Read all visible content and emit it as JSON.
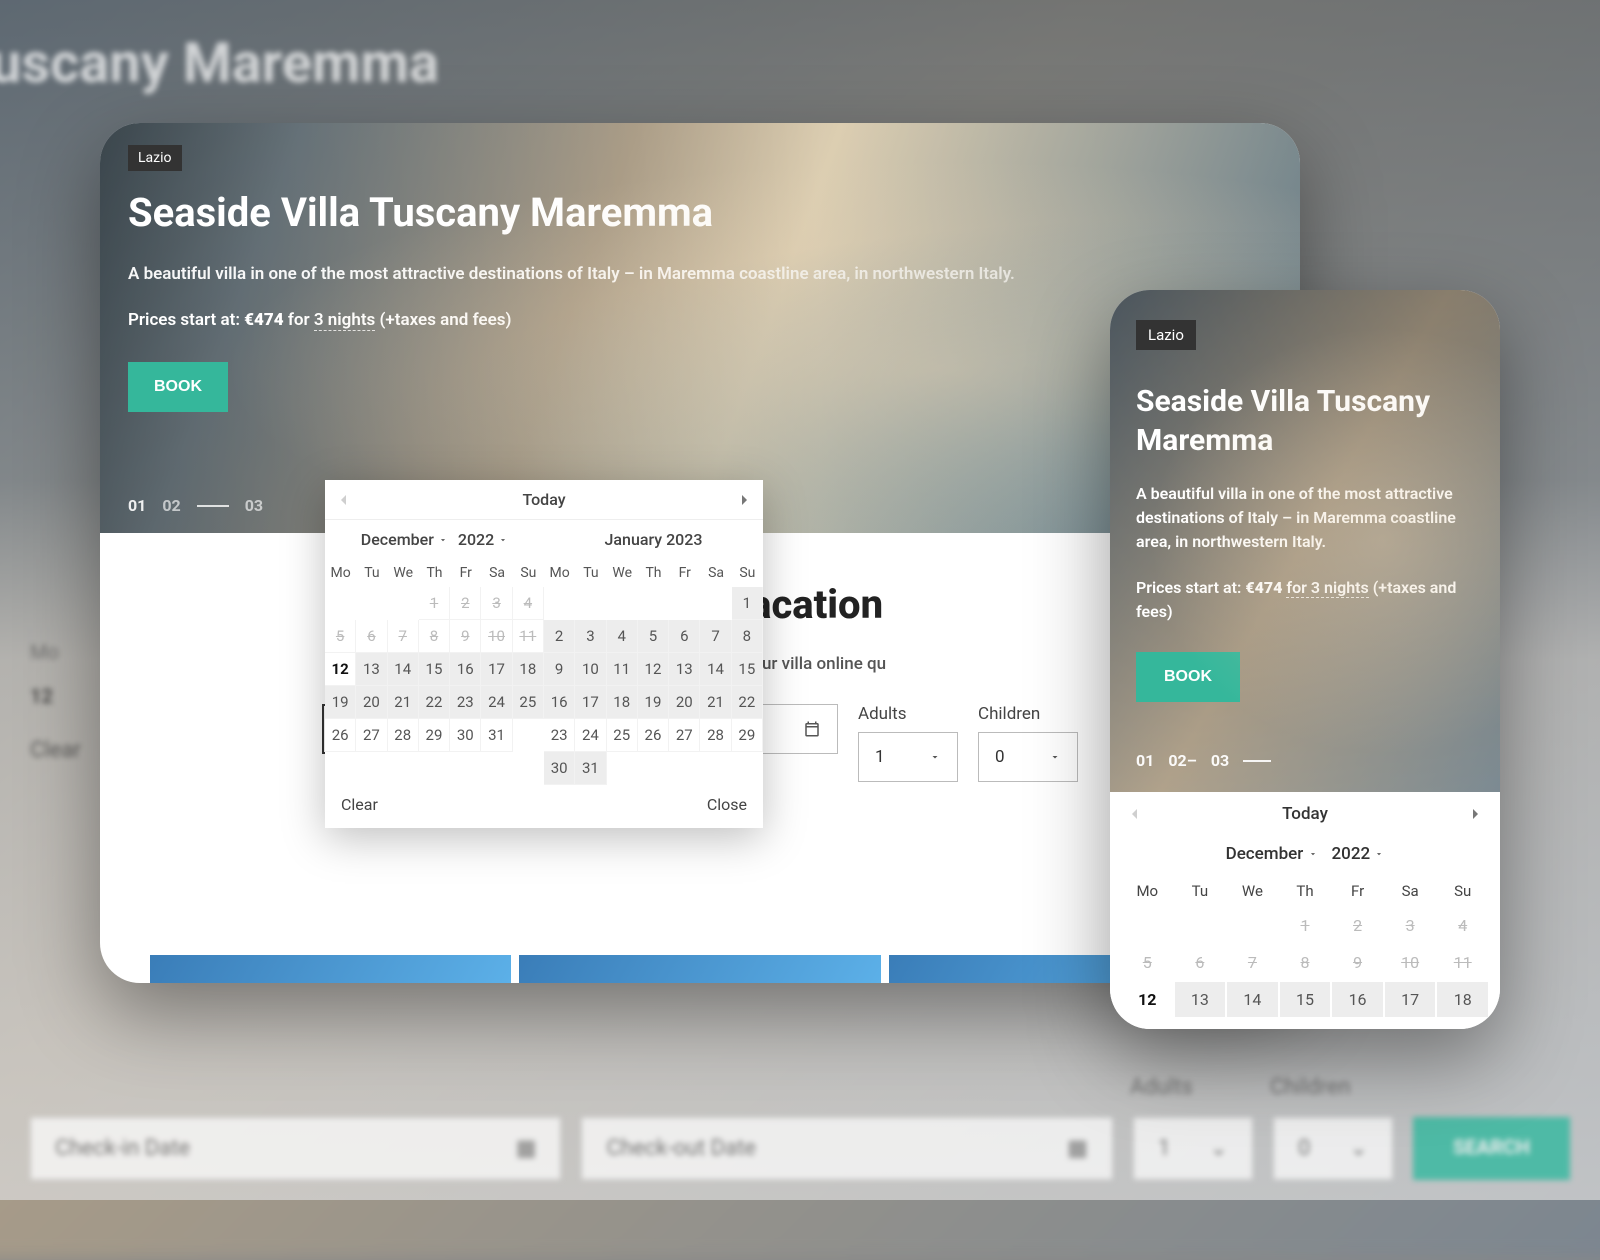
{
  "background": {
    "blurred_title": "uscany Maremma",
    "clear": "Clear",
    "close": "Close",
    "checkin": "Check-in Date",
    "checkout": "Check-out Date",
    "adults_label": "Adults",
    "adults_value": "1",
    "children_label": "Children",
    "children_value": "0",
    "search": "SEARCH"
  },
  "hero": {
    "tag": "Lazio",
    "title": "Seaside Villa Tuscany Maremma",
    "description": "A beautiful villa in one of the most attractive destinations of Italy – in Maremma coastline area, in northwestern Italy.",
    "price_prefix": "Prices start at: ",
    "price_amount": "€474",
    "price_mid": " for ",
    "nights": "3 nights",
    "price_suffix": " (+taxes and fees)",
    "book_label": "BOOK",
    "indicators": [
      "01",
      "02",
      "03"
    ]
  },
  "marketing": {
    "headline_fragment": "ert for your vacation",
    "subline_fragment": "nd your dream vacation. Book your villa online qu"
  },
  "search": {
    "adults_label": "Adults",
    "adults_value": "1",
    "children_label": "Children",
    "children_value": "0",
    "checkin_placeholder": "Check-in Date",
    "checkout_placeholder": "Check-out Date"
  },
  "datepicker": {
    "today_label": "Today",
    "clear_label": "Clear",
    "close_label": "Close",
    "month1": {
      "name": "December",
      "year": "2022"
    },
    "month2": {
      "name": "January 2023"
    },
    "dow": [
      "Mo",
      "Tu",
      "We",
      "Th",
      "Fr",
      "Sa",
      "Su"
    ],
    "dec_leading_empty": 3,
    "dec_days": [
      {
        "n": 1,
        "s": "disabled"
      },
      {
        "n": 2,
        "s": "disabled"
      },
      {
        "n": 3,
        "s": "disabled"
      },
      {
        "n": 4,
        "s": "disabled"
      },
      {
        "n": 5,
        "s": "disabled"
      },
      {
        "n": 6,
        "s": "disabled"
      },
      {
        "n": 7,
        "s": "disabled"
      },
      {
        "n": 8,
        "s": "disabled"
      },
      {
        "n": 9,
        "s": "disabled"
      },
      {
        "n": 10,
        "s": "disabled"
      },
      {
        "n": 11,
        "s": "disabled"
      },
      {
        "n": 12,
        "s": "today"
      },
      {
        "n": 13,
        "s": "avail"
      },
      {
        "n": 14,
        "s": "avail"
      },
      {
        "n": 15,
        "s": "avail"
      },
      {
        "n": 16,
        "s": "avail"
      },
      {
        "n": 17,
        "s": "avail"
      },
      {
        "n": 18,
        "s": "avail"
      },
      {
        "n": 19,
        "s": "avail"
      },
      {
        "n": 20,
        "s": "avail"
      },
      {
        "n": 21,
        "s": "avail"
      },
      {
        "n": 22,
        "s": "avail"
      },
      {
        "n": 23,
        "s": "avail"
      },
      {
        "n": 24,
        "s": "avail"
      },
      {
        "n": 25,
        "s": "avail"
      },
      {
        "n": 26,
        "s": ""
      },
      {
        "n": 27,
        "s": ""
      },
      {
        "n": 28,
        "s": ""
      },
      {
        "n": 29,
        "s": ""
      },
      {
        "n": 30,
        "s": ""
      },
      {
        "n": 31,
        "s": ""
      }
    ],
    "jan_leading_empty": 6,
    "jan_days": [
      {
        "n": 1,
        "s": "avail"
      },
      {
        "n": 2,
        "s": "avail"
      },
      {
        "n": 3,
        "s": "avail"
      },
      {
        "n": 4,
        "s": "avail"
      },
      {
        "n": 5,
        "s": "avail"
      },
      {
        "n": 6,
        "s": "avail"
      },
      {
        "n": 7,
        "s": "avail"
      },
      {
        "n": 8,
        "s": "avail"
      },
      {
        "n": 9,
        "s": "avail"
      },
      {
        "n": 10,
        "s": "avail"
      },
      {
        "n": 11,
        "s": "avail"
      },
      {
        "n": 12,
        "s": "avail"
      },
      {
        "n": 13,
        "s": "avail"
      },
      {
        "n": 14,
        "s": "avail"
      },
      {
        "n": 15,
        "s": "avail"
      },
      {
        "n": 16,
        "s": "avail"
      },
      {
        "n": 17,
        "s": "avail"
      },
      {
        "n": 18,
        "s": "avail"
      },
      {
        "n": 19,
        "s": "avail"
      },
      {
        "n": 20,
        "s": "avail"
      },
      {
        "n": 21,
        "s": "avail"
      },
      {
        "n": 22,
        "s": "avail"
      },
      {
        "n": 23,
        "s": ""
      },
      {
        "n": 24,
        "s": ""
      },
      {
        "n": 25,
        "s": ""
      },
      {
        "n": 26,
        "s": ""
      },
      {
        "n": 27,
        "s": ""
      },
      {
        "n": 28,
        "s": ""
      },
      {
        "n": 29,
        "s": ""
      },
      {
        "n": 30,
        "s": "avail"
      },
      {
        "n": 31,
        "s": "avail"
      }
    ]
  },
  "mobile": {
    "tag": "Lazio",
    "title": "Seaside Villa Tuscany Maremma",
    "description": "A beautiful villa in one of the most attractive destinations of Italy – in Maremma coastline area, in northwestern Italy.",
    "price_prefix": "Prices start at: ",
    "price_amount": "€474",
    "price_mid": " ",
    "nights": "for 3 nights",
    "price_suffix": " (+taxes and fees)",
    "book_label": "BOOK",
    "indicators": [
      "01",
      "02–",
      "03"
    ],
    "dp": {
      "today_label": "Today",
      "month": "December",
      "year": "2022",
      "dow": [
        "Mo",
        "Tu",
        "We",
        "Th",
        "Fr",
        "Sa",
        "Su"
      ],
      "leading_empty": 3,
      "days": [
        {
          "n": 1,
          "s": "disabled"
        },
        {
          "n": 2,
          "s": "disabled"
        },
        {
          "n": 3,
          "s": "disabled"
        },
        {
          "n": 4,
          "s": "disabled"
        },
        {
          "n": 5,
          "s": "disabled"
        },
        {
          "n": 6,
          "s": "disabled"
        },
        {
          "n": 7,
          "s": "disabled"
        },
        {
          "n": 8,
          "s": "disabled"
        },
        {
          "n": 9,
          "s": "disabled"
        },
        {
          "n": 10,
          "s": "disabled"
        },
        {
          "n": 11,
          "s": "disabled"
        },
        {
          "n": 12,
          "s": "today"
        },
        {
          "n": 13,
          "s": "avail"
        },
        {
          "n": 14,
          "s": "avail"
        },
        {
          "n": 15,
          "s": "avail"
        },
        {
          "n": 16,
          "s": "avail"
        },
        {
          "n": 17,
          "s": "avail"
        },
        {
          "n": 18,
          "s": "avail"
        }
      ]
    }
  }
}
